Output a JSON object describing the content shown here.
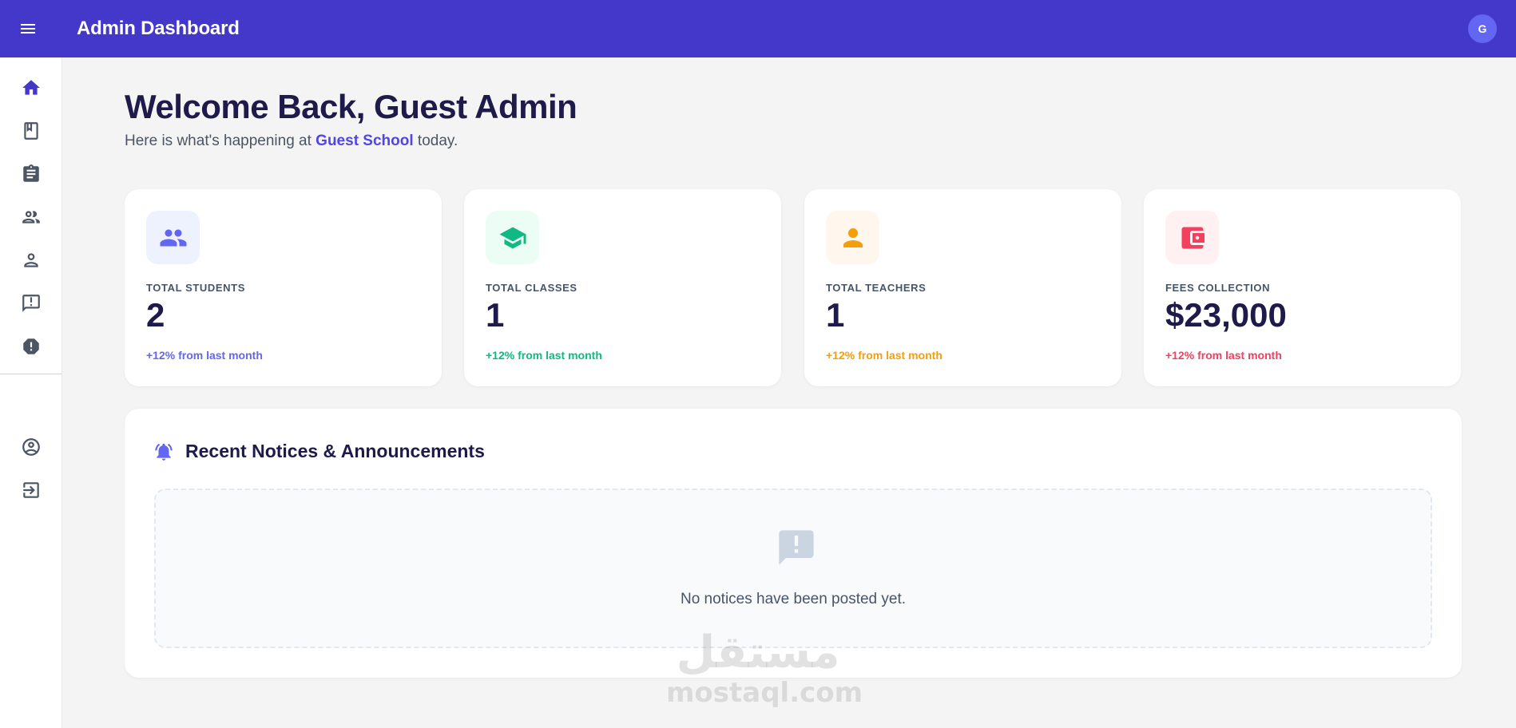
{
  "header": {
    "title": "Admin Dashboard",
    "avatar_initial": "G"
  },
  "sidebar": {
    "items": [
      {
        "icon": "home-icon",
        "active": true
      },
      {
        "icon": "book-icon",
        "active": false
      },
      {
        "icon": "clipboard-icon",
        "active": false
      },
      {
        "icon": "users-icon",
        "active": false
      },
      {
        "icon": "person-icon",
        "active": false
      },
      {
        "icon": "feedback-icon",
        "active": false
      },
      {
        "icon": "alert-icon",
        "active": false
      }
    ],
    "bottom_items": [
      {
        "icon": "account-circle-icon"
      },
      {
        "icon": "logout-icon"
      }
    ]
  },
  "welcome": {
    "title": "Welcome Back, Guest Admin",
    "subtitle_prefix": "Here is what's happening at",
    "school": "Guest School",
    "subtitle_suffix": "today."
  },
  "stats": [
    {
      "label": "TOTAL STUDENTS",
      "value": "2",
      "trend": "+12% from last month",
      "color": "#6366f1",
      "bg": "#eef2ff",
      "icon": "students-icon"
    },
    {
      "label": "TOTAL CLASSES",
      "value": "1",
      "trend": "+12% from last month",
      "color": "#10b981",
      "bg": "#ecfdf5",
      "icon": "graduation-cap-icon"
    },
    {
      "label": "TOTAL TEACHERS",
      "value": "1",
      "trend": "+12% from last month",
      "color": "#f59e0b",
      "bg": "#fff7ed",
      "icon": "teacher-icon"
    },
    {
      "label": "FEES COLLECTION",
      "value": "$23,000",
      "trend": "+12% from last month",
      "color": "#f43f5e",
      "bg": "#fff1f2",
      "icon": "wallet-icon"
    }
  ],
  "notices": {
    "title": "Recent Notices & Announcements",
    "empty_text": "No notices have been posted yet."
  },
  "watermark": {
    "arabic": "مستقل",
    "latin": "mostaql.com"
  },
  "colors": {
    "accent": "#4338ca",
    "brand": "#4f46e5",
    "icon_muted": "#4b5563",
    "empty_icon": "#cbd5e1"
  }
}
